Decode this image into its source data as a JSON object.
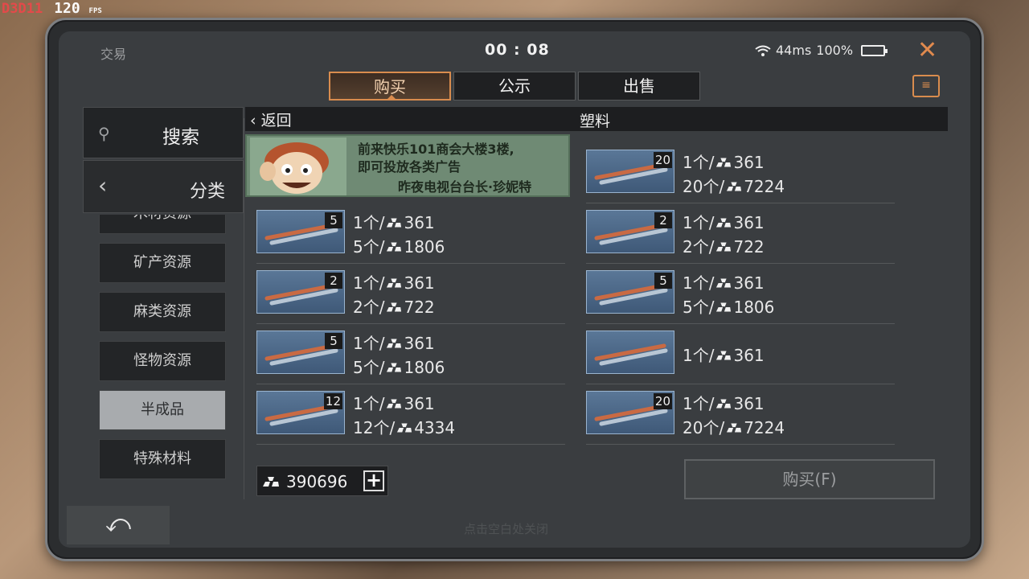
{
  "debug": {
    "renderer": "D3D11",
    "fps_value": "120",
    "fps_unit": "FPS"
  },
  "topbar": {
    "title": "交易",
    "time": "00 : 08",
    "ping": "44ms",
    "battery": "100%",
    "close_glyph": "✕"
  },
  "tabs": [
    {
      "label": "购买",
      "active": true
    },
    {
      "label": "公示",
      "active": false
    },
    {
      "label": "出售",
      "active": false
    }
  ],
  "sidebar": {
    "search_label": "搜索",
    "category_label": "分类",
    "categories": [
      {
        "label": "木材资源"
      },
      {
        "label": "矿产资源"
      },
      {
        "label": "麻类资源"
      },
      {
        "label": "怪物资源"
      },
      {
        "label": "半成品",
        "selected": true
      },
      {
        "label": "特殊材料"
      }
    ]
  },
  "header": {
    "back_label": "返回",
    "category_title": "塑料"
  },
  "ad": {
    "line1": "前来快乐101商会大楼3楼,",
    "line2": "即可投放各类广告",
    "signature": "昨夜电视台台长·珍妮特"
  },
  "listings": [
    {
      "qty": "5",
      "line1": "1个/",
      "v1": "361",
      "line2": "5个/",
      "v2": "1806"
    },
    {
      "qty": "2",
      "line1": "1个/",
      "v1": "361",
      "line2": "2个/",
      "v2": "722"
    },
    {
      "qty": "5",
      "line1": "1个/",
      "v1": "361",
      "line2": "5个/",
      "v2": "1806"
    },
    {
      "qty": "12",
      "line1": "1个/",
      "v1": "361",
      "line2": "12个/",
      "v2": "4334"
    },
    {
      "qty": "20",
      "line1": "1个/",
      "v1": "361",
      "line2": "20个/",
      "v2": "7224"
    },
    {
      "qty": "2",
      "line1": "1个/",
      "v1": "361",
      "line2": "2个/",
      "v2": "722"
    },
    {
      "qty": "5",
      "line1": "1个/",
      "v1": "361",
      "line2": "5个/",
      "v2": "1806"
    },
    {
      "qty": "",
      "line1": "1个/",
      "v1": "361",
      "line2": "",
      "v2": ""
    },
    {
      "qty": "20",
      "line1": "1个/",
      "v1": "361",
      "line2": "20个/",
      "v2": "7224"
    }
  ],
  "balance": {
    "value": "390696",
    "plus_glyph": "+"
  },
  "buy_button": {
    "label": "购买(F)"
  },
  "footer": {
    "back_glyph": "⤺",
    "hint": "点击空白处关闭"
  },
  "colors": {
    "accent": "#d98c4e",
    "panel": "#3a3d40",
    "dark": "#1d1e20"
  }
}
